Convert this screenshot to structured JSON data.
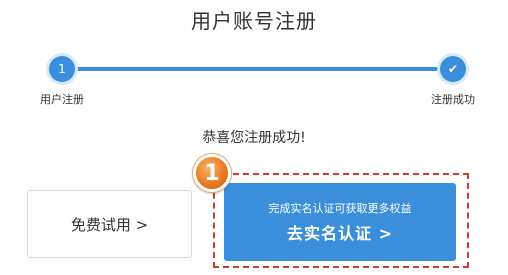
{
  "header": {
    "title": "用户账号注册"
  },
  "steps": [
    {
      "number": "1",
      "label": "用户注册",
      "icon": "number-badge"
    },
    {
      "number": "✔",
      "label": "注册成功",
      "icon": "checkmark-icon"
    }
  ],
  "message": {
    "text": "恭喜您注册成功!"
  },
  "actions": {
    "trial_label": "免费试用 >",
    "verify_subtitle": "完成实名认证可获取更多权益",
    "verify_label": "去实名认证 >"
  },
  "annotation": {
    "badge": "1"
  },
  "colors": {
    "accent": "#3b8edb",
    "highlight": "#d43a30",
    "badge": "#ea7b22"
  }
}
